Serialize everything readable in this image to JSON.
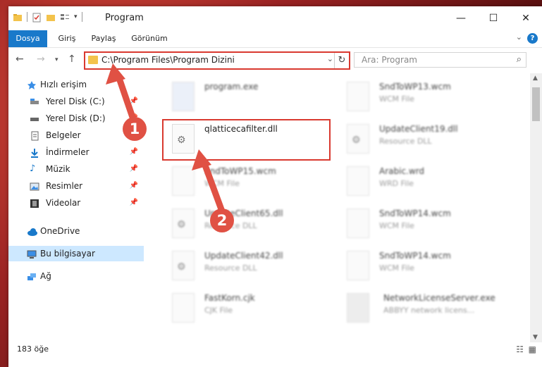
{
  "window": {
    "title": "Program",
    "buttons": [
      "—",
      "☐",
      "✕"
    ]
  },
  "ribbon": {
    "tabs": [
      "Dosya",
      "Giriş",
      "Paylaş",
      "Görünüm"
    ],
    "help": "?"
  },
  "nav": {
    "address": "C:\\Program Files\\Program Dizini",
    "search_placeholder": "Ara: Program"
  },
  "sidebar": {
    "items": [
      {
        "label": "Hızlı erişim",
        "icon": "star-icon",
        "pinned": false
      },
      {
        "label": "Yerel Disk (C:)",
        "icon": "drive-icon",
        "pinned": true
      },
      {
        "label": "Yerel Disk (D:)",
        "icon": "drive-icon",
        "pinned": true
      },
      {
        "label": "Belgeler",
        "icon": "documents-icon",
        "pinned": true
      },
      {
        "label": "İndirmeler",
        "icon": "download-icon",
        "pinned": true
      },
      {
        "label": "Müzik",
        "icon": "music-icon",
        "pinned": true
      },
      {
        "label": "Resimler",
        "icon": "pictures-icon",
        "pinned": true
      },
      {
        "label": "Videolar",
        "icon": "video-icon",
        "pinned": true
      },
      {
        "label": "OneDrive",
        "icon": "cloud-icon",
        "pinned": false
      },
      {
        "label": "Bu bilgisayar",
        "icon": "computer-icon",
        "pinned": false
      },
      {
        "label": "Ağ",
        "icon": "network-icon",
        "pinned": false
      }
    ]
  },
  "files": [
    {
      "name": "program.exe",
      "sub": ""
    },
    {
      "name": "SndToWP13.wcm",
      "sub": "WCM File"
    },
    {
      "name": "qlatticecafilter.dll",
      "sub": ""
    },
    {
      "name": "UpdateClient19.dll",
      "sub": "Resource DLL"
    },
    {
      "name": "SndToWP15.wcm",
      "sub": "WCM File"
    },
    {
      "name": "Arabic.wrd",
      "sub": "WRD File"
    },
    {
      "name": "UpdateClient65.dll",
      "sub": "Resource DLL"
    },
    {
      "name": "SndToWP14.wcm",
      "sub": "WCM File"
    },
    {
      "name": "UpdateClient42.dll",
      "sub": "Resource DLL"
    },
    {
      "name": "SndToWP14.wcm",
      "sub": "WCM File"
    },
    {
      "name": "FastKorn.cjk",
      "sub": "CJK File"
    },
    {
      "name": "NetworkLicenseServer.exe",
      "sub": "ABBYY network licens..."
    }
  ],
  "status": {
    "count": "183 öğe"
  },
  "annotations": {
    "badge1": "1",
    "badge2": "2",
    "color": "#e05144"
  }
}
